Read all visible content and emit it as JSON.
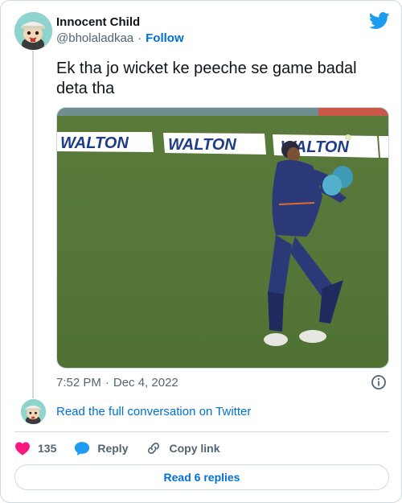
{
  "author": {
    "name": "Innocent Child",
    "handle": "@bholaladkaa",
    "separator": "·",
    "follow_label": "Follow",
    "avatar_icon": "cartoon-child-avatar"
  },
  "brand_icon": "twitter-bird-icon",
  "tweet": {
    "text": "Ek tha jo wicket ke peeche se game badal deta tha",
    "time": "7:52 PM",
    "separator": "·",
    "date": "Dec 4, 2022"
  },
  "media": {
    "boards": [
      "WALTON",
      "WALTON",
      "WALTON"
    ]
  },
  "conversation_link": "Read the full conversation on Twitter",
  "actions": {
    "likes": "135",
    "reply_label": "Reply",
    "copy_label": "Copy link"
  },
  "read_replies_label": "Read 6 replies",
  "colors": {
    "accent": "#006fd6",
    "heart": "#f91880",
    "border": "#cfd9de",
    "muted": "#536471",
    "bird": "#1d9bf0"
  }
}
